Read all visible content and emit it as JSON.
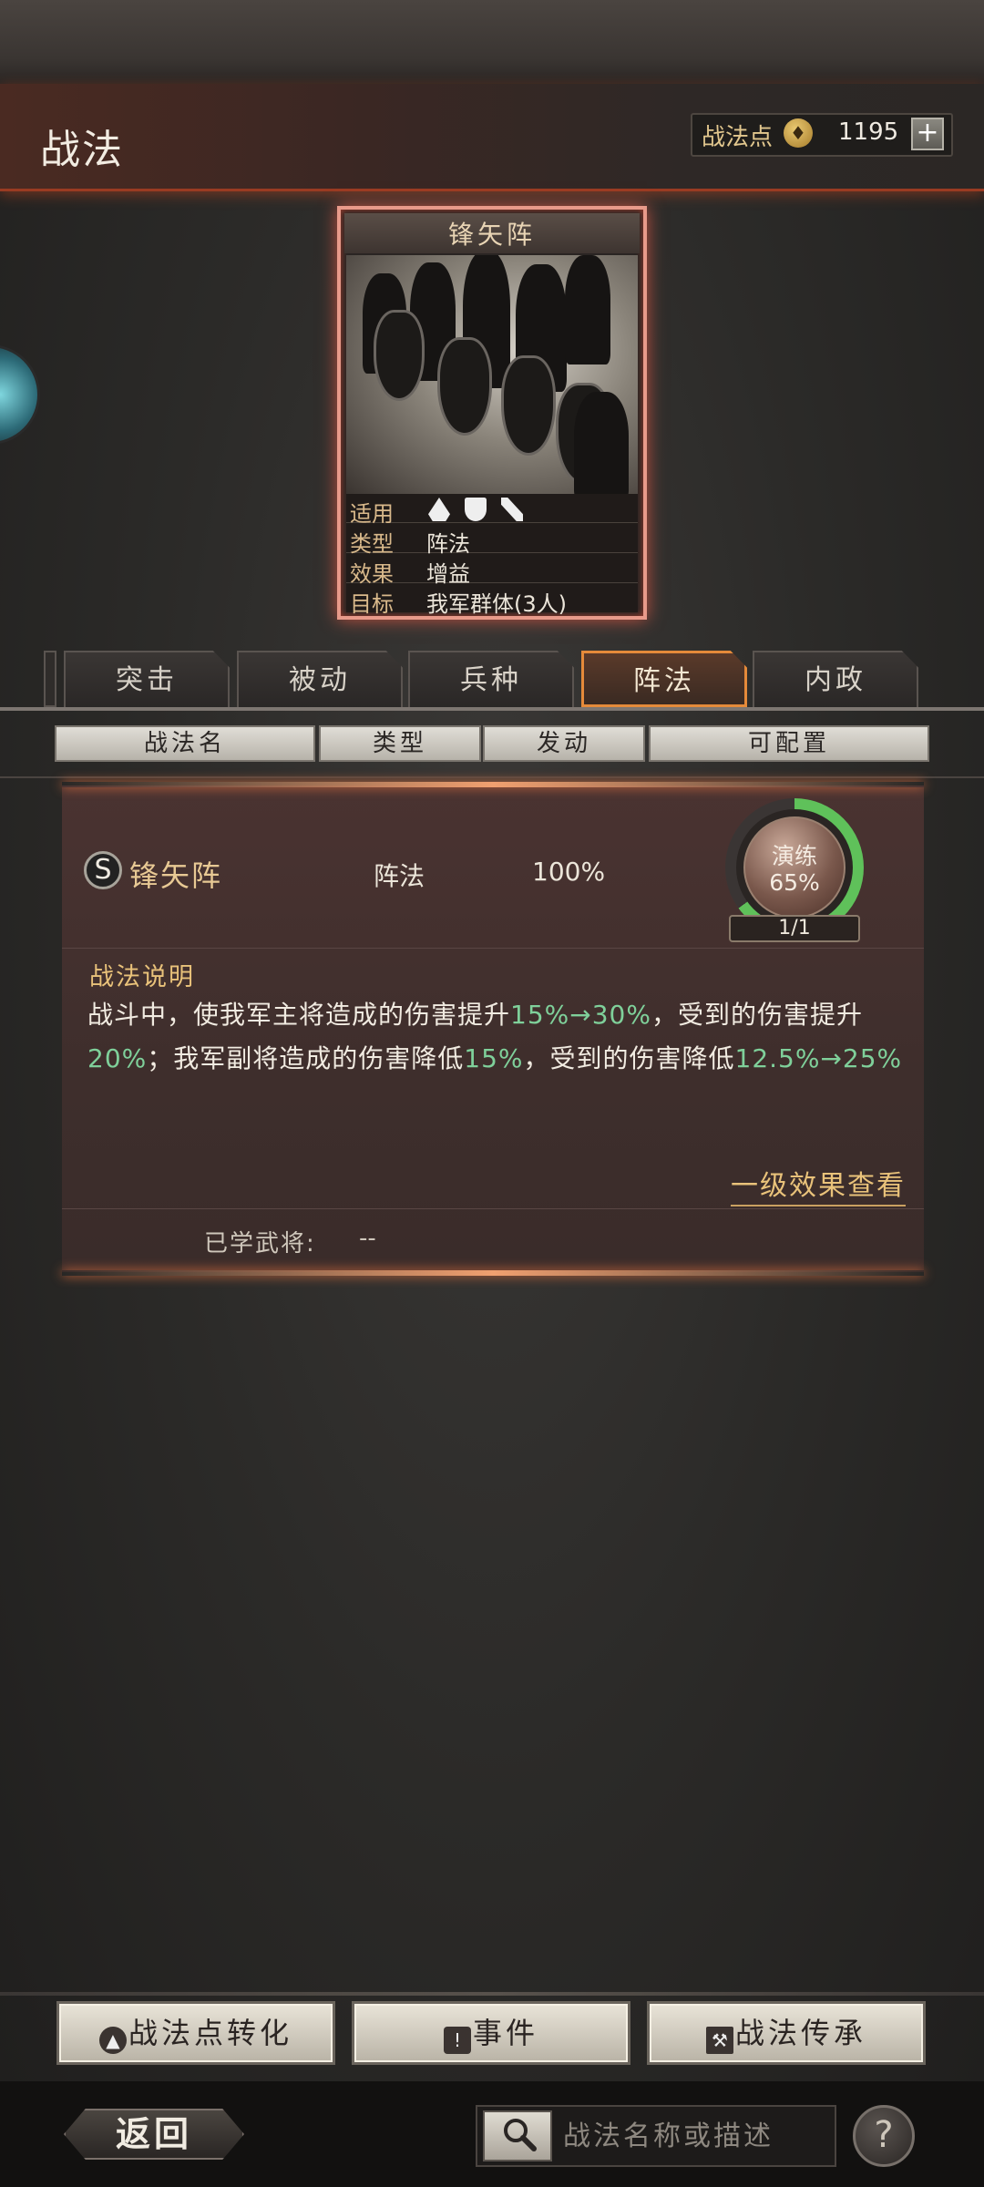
{
  "header": {
    "title": "战法",
    "points_label": "战法点",
    "points_value": "1195",
    "plus_label": "+"
  },
  "card": {
    "title": "锋矢阵",
    "rows": [
      {
        "key": "适用",
        "value": ""
      },
      {
        "key": "类型",
        "value": "阵法"
      },
      {
        "key": "效果",
        "value": "增益"
      },
      {
        "key": "目标",
        "value": "我军群体(3人)"
      }
    ],
    "unit_icons": [
      "cavalry-icon",
      "shield-icon",
      "bow-icon"
    ]
  },
  "tabs": [
    {
      "label": "突击"
    },
    {
      "label": "被动"
    },
    {
      "label": "兵种"
    },
    {
      "label": "阵法",
      "active": true
    },
    {
      "label": "内政"
    }
  ],
  "columns": [
    "战法名",
    "类型",
    "发动",
    "可配置"
  ],
  "skill": {
    "grade": "S",
    "name": "锋矢阵",
    "type": "阵法",
    "rate": "100%",
    "practice_label": "演练",
    "practice_pct": "65%",
    "practice_fraction": 0.65,
    "count": "1/1",
    "desc_title": "战法说明",
    "desc_parts": [
      {
        "t": "战斗中，使我军主将造成的伤害提升"
      },
      {
        "t": "15%→30%",
        "hl": true
      },
      {
        "t": "，受到的伤害提升"
      },
      {
        "t": "20%",
        "hl": true
      },
      {
        "t": "；我军副将造成的伤害降低"
      },
      {
        "t": "15%",
        "hl": true
      },
      {
        "t": "，受到的伤害降低"
      },
      {
        "t": "12.5%→25%",
        "hl": true
      }
    ],
    "level_link": "一级效果查看",
    "learned_label": "已学武将:",
    "learned_value": "--"
  },
  "bottom_buttons": [
    {
      "label": "战法点转化",
      "icon": "flame-icon"
    },
    {
      "label": "事件",
      "icon": "alert-icon"
    },
    {
      "label": "战法传承",
      "icon": "hammer-icon"
    }
  ],
  "footer": {
    "back_label": "返回",
    "search_placeholder": "战法名称或描述",
    "help_label": "?"
  },
  "colors": {
    "accent": "#e58a3a",
    "highlight": "#7fd09a",
    "gold": "#e9c27a",
    "progress": "#5fc15a"
  }
}
